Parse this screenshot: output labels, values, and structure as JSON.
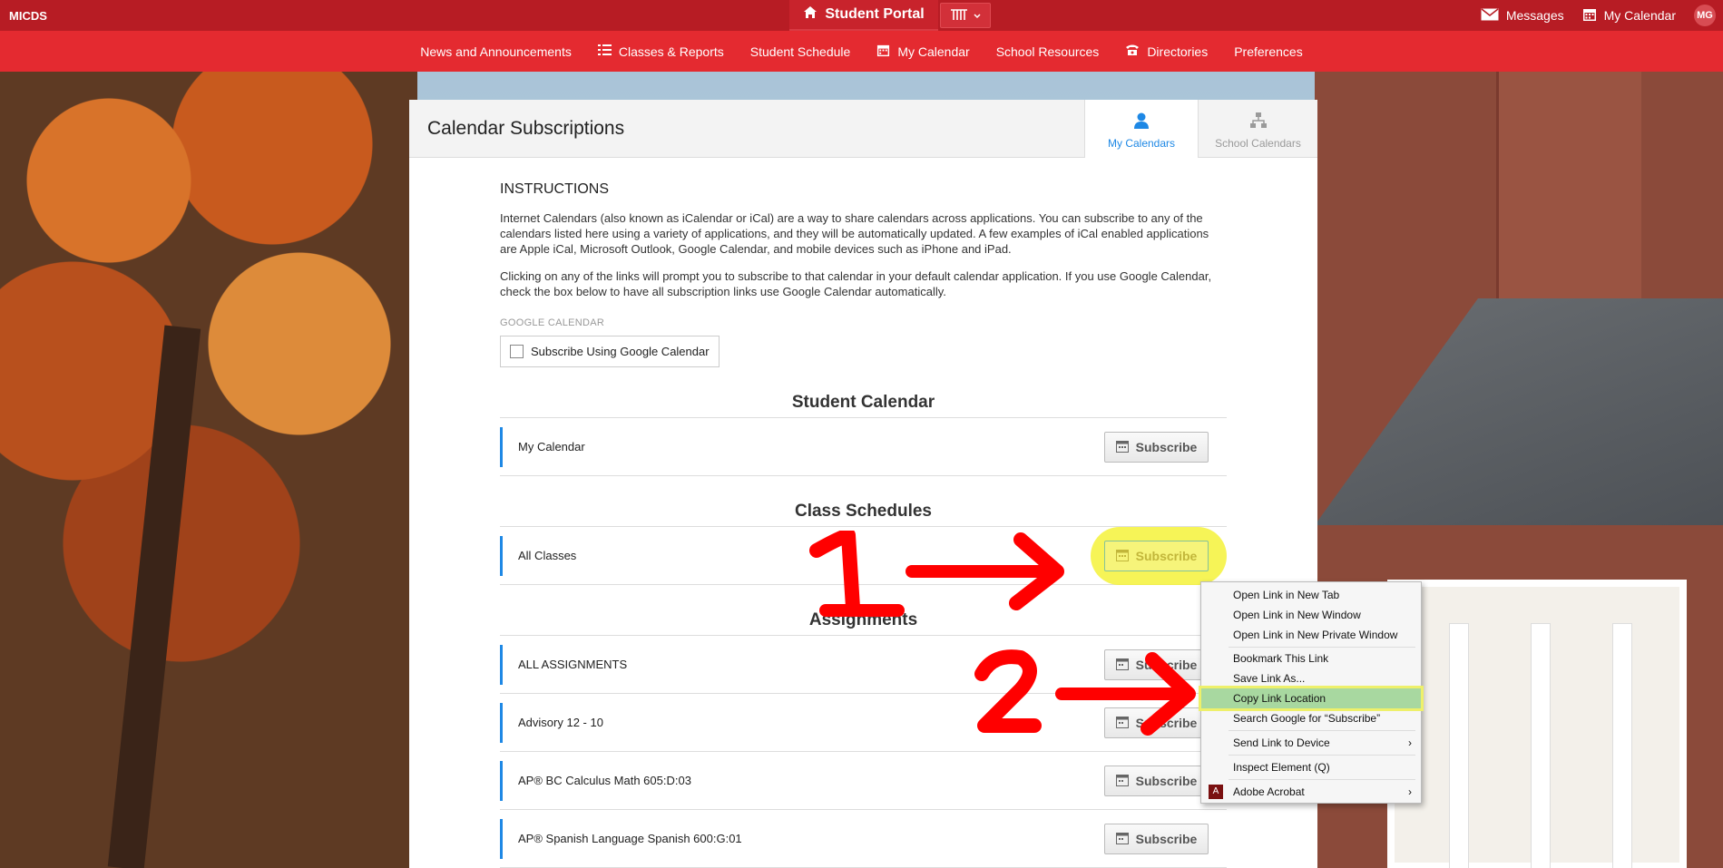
{
  "brand": "MICDS",
  "portal_label": "Student Portal",
  "top_right": {
    "messages": "Messages",
    "my_calendar": "My Calendar",
    "avatar_initials": "MG"
  },
  "nav": [
    {
      "label": "News and Announcements"
    },
    {
      "label": "Classes & Reports"
    },
    {
      "label": "Student Schedule"
    },
    {
      "label": "My Calendar"
    },
    {
      "label": "School Resources"
    },
    {
      "label": "Directories"
    },
    {
      "label": "Preferences"
    }
  ],
  "page": {
    "title": "Calendar Subscriptions",
    "tabs": {
      "my_calendars": "My Calendars",
      "school_calendars": "School Calendars"
    },
    "instructions_heading": "INSTRUCTIONS",
    "para1": "Internet Calendars (also known as iCalendar or iCal) are a way to share calendars across applications. You can subscribe to any of the calendars listed here using a variety of applications, and they will be automatically updated. A few examples of iCal enabled applications are Apple iCal, Microsoft Outlook, Google Calendar, and mobile devices such as iPhone and iPad.",
    "para2": "Clicking on any of the links will prompt you to subscribe to that calendar in your default calendar application. If you use Google Calendar, check the box below to have all subscription links use Google Calendar automatically.",
    "google_label": "GOOGLE CALENDAR",
    "google_checkbox": "Subscribe Using Google Calendar",
    "subscribe_label": "Subscribe",
    "sections": {
      "student": {
        "title": "Student Calendar",
        "rows": [
          "My Calendar"
        ]
      },
      "classes": {
        "title": "Class Schedules",
        "rows": [
          "All Classes"
        ]
      },
      "assignments": {
        "title": "Assignments",
        "rows": [
          "ALL ASSIGNMENTS",
          "Advisory 12 - 10",
          "AP® BC Calculus Math 605:D:03",
          "AP® Spanish Language Spanish 600:G:01"
        ]
      }
    }
  },
  "context_menu": {
    "items": [
      "Open Link in New Tab",
      "Open Link in New Window",
      "Open Link in New Private Window",
      "Bookmark This Link",
      "Save Link As...",
      "Copy Link Location",
      "Search Google for “Subscribe”",
      "Send Link to Device",
      "Inspect Element (Q)",
      "Adobe Acrobat"
    ],
    "selected": "Copy Link Location"
  },
  "annotations": {
    "step1": "1",
    "step2": "2"
  },
  "colors": {
    "top_bar": "#b71c24",
    "nav_bar": "#e42a30",
    "accent_blue": "#1e88e5",
    "highlight_yellow": "#f4f23a",
    "annotation_red": "#ff0000"
  }
}
